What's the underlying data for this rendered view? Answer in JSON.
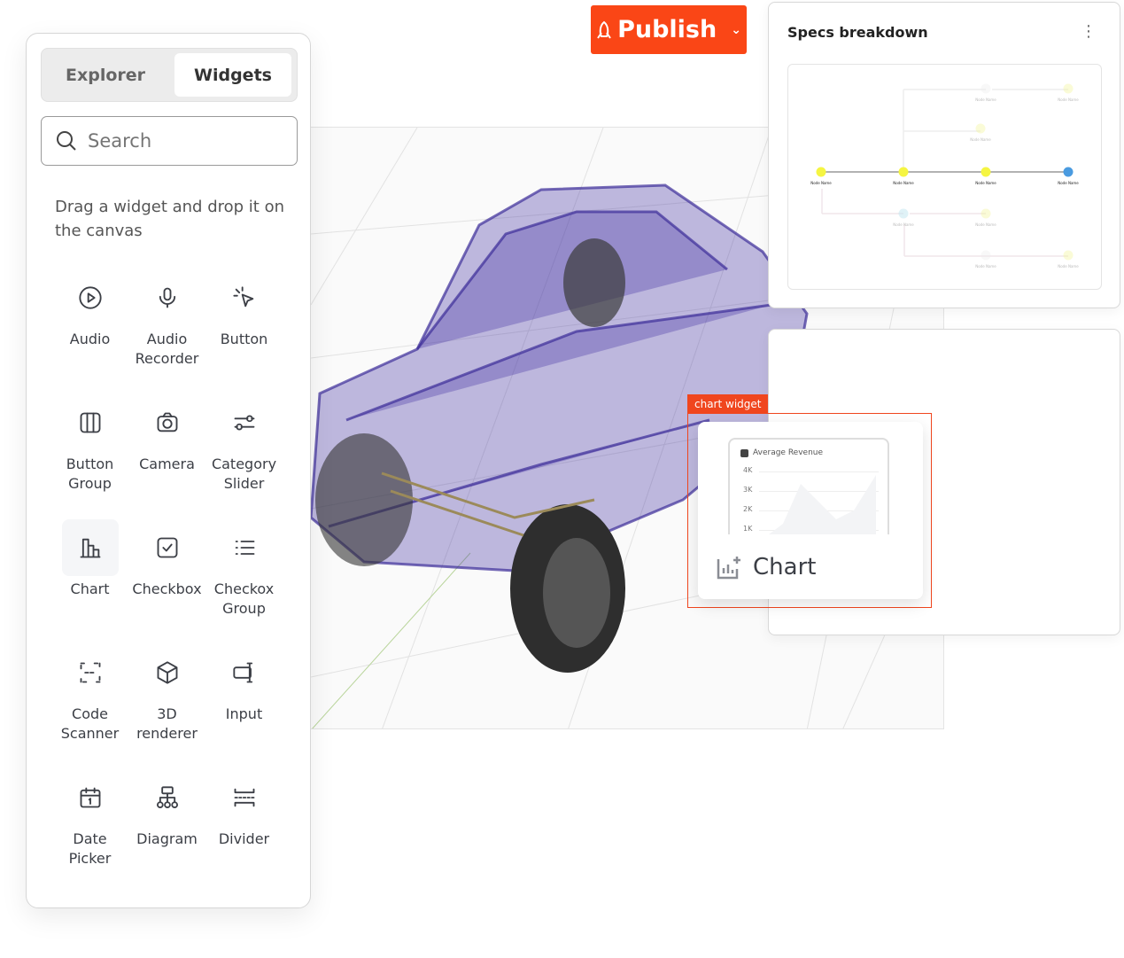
{
  "tabs": [
    {
      "label": "Explorer",
      "active": false
    },
    {
      "label": "Widgets",
      "active": true
    }
  ],
  "search": {
    "placeholder": "Search"
  },
  "hint": "Drag a widget and drop it on the canvas",
  "widgets": [
    {
      "label": "Audio",
      "icon": "play-circle-icon"
    },
    {
      "label": "Audio Recorder",
      "icon": "microphone-icon"
    },
    {
      "label": "Button",
      "icon": "cursor-click-icon"
    },
    {
      "label": "Button Group",
      "icon": "columns-icon"
    },
    {
      "label": "Camera",
      "icon": "camera-icon"
    },
    {
      "label": "Category Slider",
      "icon": "slider-icon"
    },
    {
      "label": "Chart",
      "icon": "bar-chart-icon",
      "selected": true
    },
    {
      "label": "Checkbox",
      "icon": "checkbox-icon"
    },
    {
      "label": "Checkox Group",
      "icon": "list-icon"
    },
    {
      "label": "Code Scanner",
      "icon": "scan-icon"
    },
    {
      "label": "3D renderer",
      "icon": "cube-icon"
    },
    {
      "label": "Input",
      "icon": "input-icon"
    },
    {
      "label": "Date Picker",
      "icon": "calendar-icon"
    },
    {
      "label": "Diagram",
      "icon": "hierarchy-icon"
    },
    {
      "label": "Divider",
      "icon": "divider-icon"
    }
  ],
  "publish": {
    "label": "Publish",
    "color": "#fa4616"
  },
  "specs": {
    "title": "Specs breakdown",
    "node_label": "Node Name"
  },
  "chart_widget": {
    "tag": "chart widget",
    "label": "Chart",
    "legend": "Average Revenue",
    "ticks": [
      "4K",
      "3K",
      "2K",
      "1K"
    ],
    "accent": "#f0461e"
  }
}
